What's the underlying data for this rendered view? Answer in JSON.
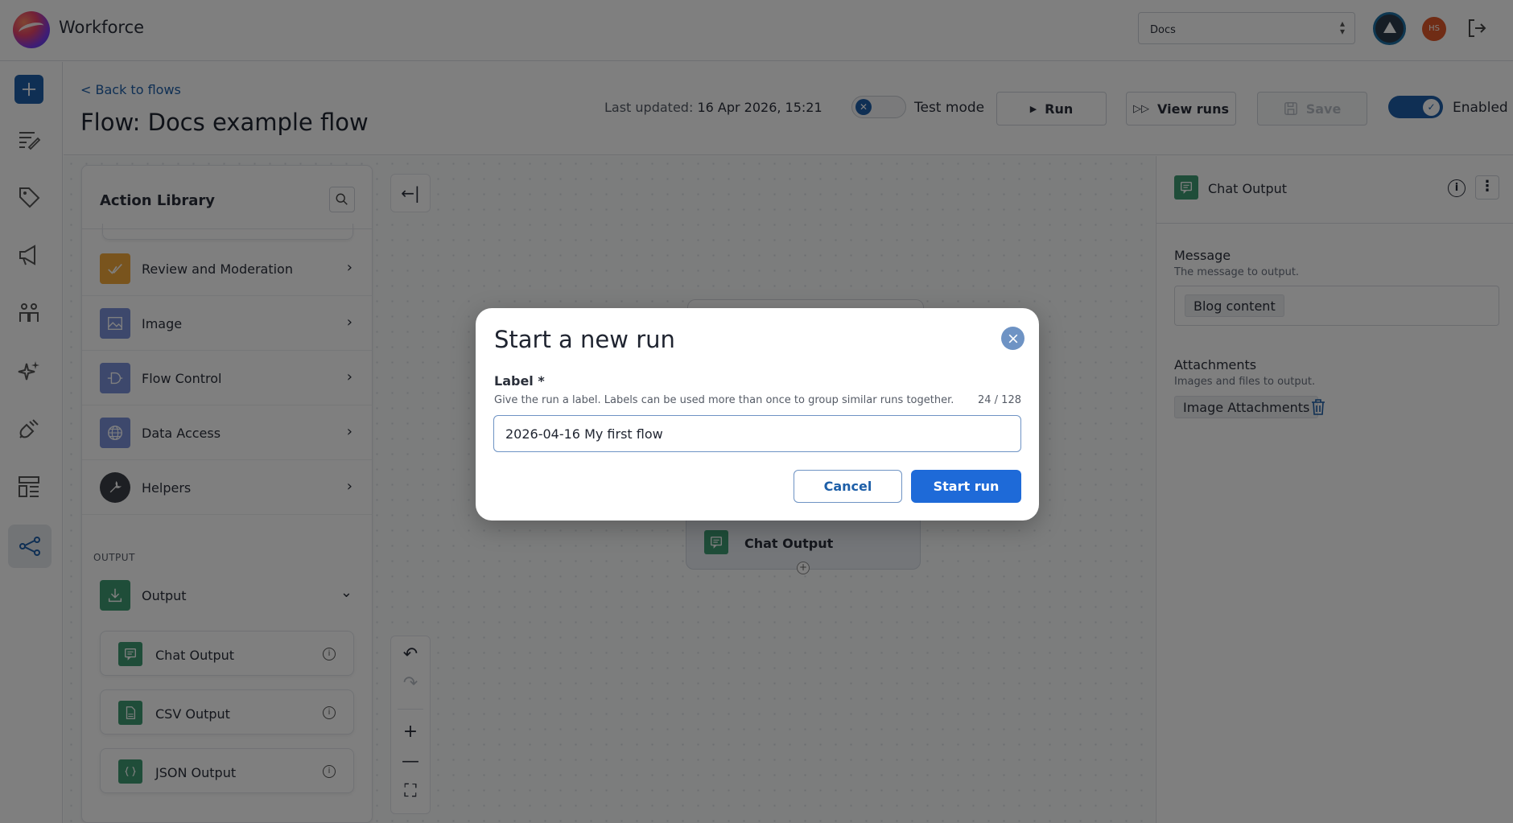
{
  "app": {
    "name": "Workforce",
    "workspace_select": "Docs",
    "avatar_initials": "HS"
  },
  "header": {
    "back_link": "< Back to flows",
    "title_prefix": "Flow:",
    "title_name": "Docs example flow",
    "last_updated_label": "Last updated:",
    "last_updated_value": "16 Apr 2026, 15:21",
    "test_mode_label": "Test mode",
    "run_label": "Run",
    "view_runs_label": "View runs",
    "save_label": "Save",
    "enabled_label": "Enabled"
  },
  "library": {
    "title": "Action Library",
    "categories": [
      {
        "label": "Review and Moderation",
        "icon": "review-icon",
        "color": "#f2a93b"
      },
      {
        "label": "Image",
        "icon": "image-icon",
        "color": "#7b90d8"
      },
      {
        "label": "Flow Control",
        "icon": "flow-control-icon",
        "color": "#7b90d8"
      },
      {
        "label": "Data Access",
        "icon": "globe-icon",
        "color": "#7b90d8"
      },
      {
        "label": "Helpers",
        "icon": "wrench-icon",
        "color": "#3b3f47"
      }
    ],
    "output_section": "OUTPUT",
    "output_group": "Output",
    "output_items": [
      {
        "label": "Chat Output",
        "icon": "chat-icon"
      },
      {
        "label": "CSV Output",
        "icon": "csv-icon"
      },
      {
        "label": "JSON Output",
        "icon": "json-icon"
      }
    ]
  },
  "canvas": {
    "node_label": "Chat Output"
  },
  "panel": {
    "title": "Chat Output",
    "message_label": "Message",
    "message_help": "The message to output.",
    "message_chip": "Blog content",
    "attachments_label": "Attachments",
    "attachments_help": "Images and files to output.",
    "attachments_chip": "Image Attachments"
  },
  "modal": {
    "title": "Start a new run",
    "label": "Label *",
    "help": "Give the run a label. Labels can be used more than once to group similar runs together.",
    "count": "24 / 128",
    "input_value": "2026-04-16 My first flow",
    "cancel_label": "Cancel",
    "start_label": "Start run"
  },
  "colors": {
    "primary": "#1e5fa8",
    "output_green": "#3f9b73",
    "overlay": "rgba(0,0,0,0.5)"
  }
}
